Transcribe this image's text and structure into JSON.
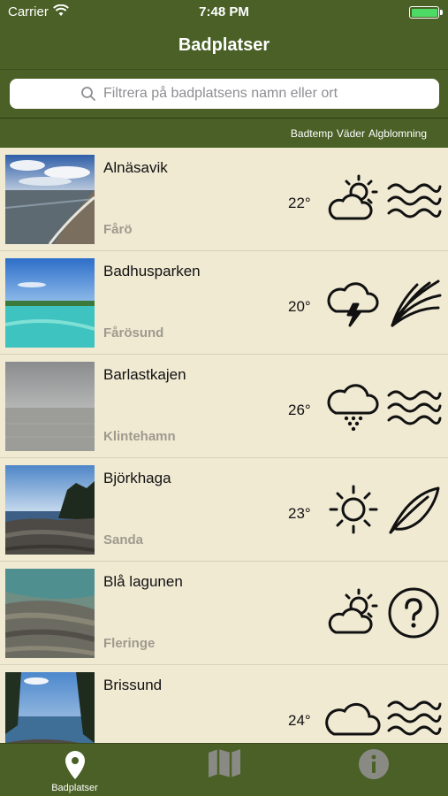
{
  "status": {
    "carrier": "Carrier",
    "time": "7:48 PM"
  },
  "nav": {
    "title": "Badplatser"
  },
  "search": {
    "placeholder": "Filtrera på badplatsens namn eller ort"
  },
  "columns": {
    "badtemp": "Badtemp",
    "vader": "Väder",
    "algblomning": "Algblomning"
  },
  "beaches": [
    {
      "name": "Alnäsavik",
      "place": "Fårö",
      "temp": "22°",
      "weather": "partly-cloudy-icon",
      "algae": "waves-icon"
    },
    {
      "name": "Badhusparken",
      "place": "Fårösund",
      "temp": "20°",
      "weather": "thunderstorm-icon",
      "algae": "seaweed-icon"
    },
    {
      "name": "Barlastkajen",
      "place": "Klintehamn",
      "temp": "26°",
      "weather": "rain-cloud-icon",
      "algae": "waves-icon"
    },
    {
      "name": "Björkhaga",
      "place": "Sanda",
      "temp": "23°",
      "weather": "sun-icon",
      "algae": "leaf-icon"
    },
    {
      "name": "Blå lagunen",
      "place": "Fleringe",
      "temp": "",
      "weather": "partly-cloudy-icon",
      "algae": "question-icon"
    },
    {
      "name": "Brissund",
      "place": "",
      "temp": "24°",
      "weather": "cloud-icon",
      "algae": "waves-icon"
    }
  ],
  "tabs": [
    {
      "label": "Badplatser"
    },
    {
      "label": ""
    },
    {
      "label": ""
    }
  ],
  "colors": {
    "bar": "#4a6026",
    "list_bg": "#f0ead3",
    "battery": "#4cd964"
  }
}
